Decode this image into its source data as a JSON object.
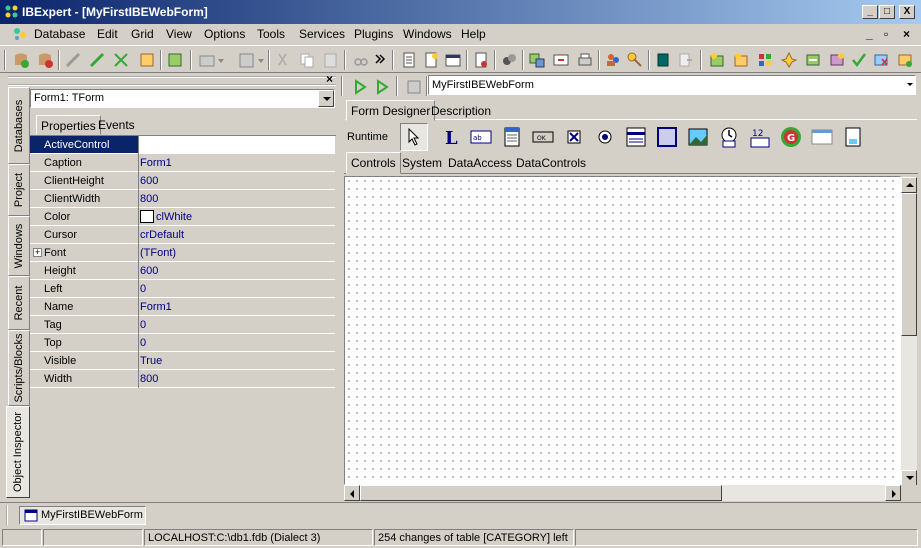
{
  "window": {
    "title": "IBExpert - [MyFirstIBEWebForm]",
    "min": "_",
    "max": "□",
    "close": "X"
  },
  "menu": [
    "Database",
    "Edit",
    "Grid",
    "View",
    "Options",
    "Tools",
    "Services",
    "Plugins",
    "Windows",
    "Help"
  ],
  "mdi": {
    "min": "_",
    "restore": "▫",
    "close": "×"
  },
  "left_tabs": [
    "Databases",
    "Project",
    "Windows",
    "Recent",
    "Scripts/Blocks",
    "Object Inspector"
  ],
  "inspector": {
    "close": "×",
    "selector": "Form1: TForm",
    "tabs": [
      "Properties",
      "Events"
    ],
    "properties": [
      {
        "name": "ActiveControl",
        "value": ""
      },
      {
        "name": "Caption",
        "value": "Form1"
      },
      {
        "name": "ClientHeight",
        "value": "600"
      },
      {
        "name": "ClientWidth",
        "value": "800"
      },
      {
        "name": "Color",
        "value": "clWhite"
      },
      {
        "name": "Cursor",
        "value": "crDefault"
      },
      {
        "name": "Font",
        "value": "(TFont)"
      },
      {
        "name": "Height",
        "value": "600"
      },
      {
        "name": "Left",
        "value": "0"
      },
      {
        "name": "Name",
        "value": "Form1"
      },
      {
        "name": "Tag",
        "value": "0"
      },
      {
        "name": "Top",
        "value": "0"
      },
      {
        "name": "Visible",
        "value": "True"
      },
      {
        "name": "Width",
        "value": "800"
      }
    ],
    "font_expander": "+"
  },
  "designer": {
    "form_name": "MyFirstIBEWebForm",
    "tabs": [
      "Form Designer",
      "Description"
    ],
    "runtime_label": "Runtime",
    "palette_tabs": [
      "Controls",
      "System",
      "DataAccess",
      "DataControls"
    ]
  },
  "taskbar": {
    "button": "MyFirstIBEWebForm"
  },
  "status": {
    "connection": "LOCALHOST:C:\\db1.fdb (Dialect 3)",
    "message": "254 changes of table [CATEGORY] left"
  },
  "colors": {
    "title_start": "#0a246a",
    "title_end": "#a6caf0",
    "selection": "#0a246a",
    "value_text": "#000080"
  }
}
